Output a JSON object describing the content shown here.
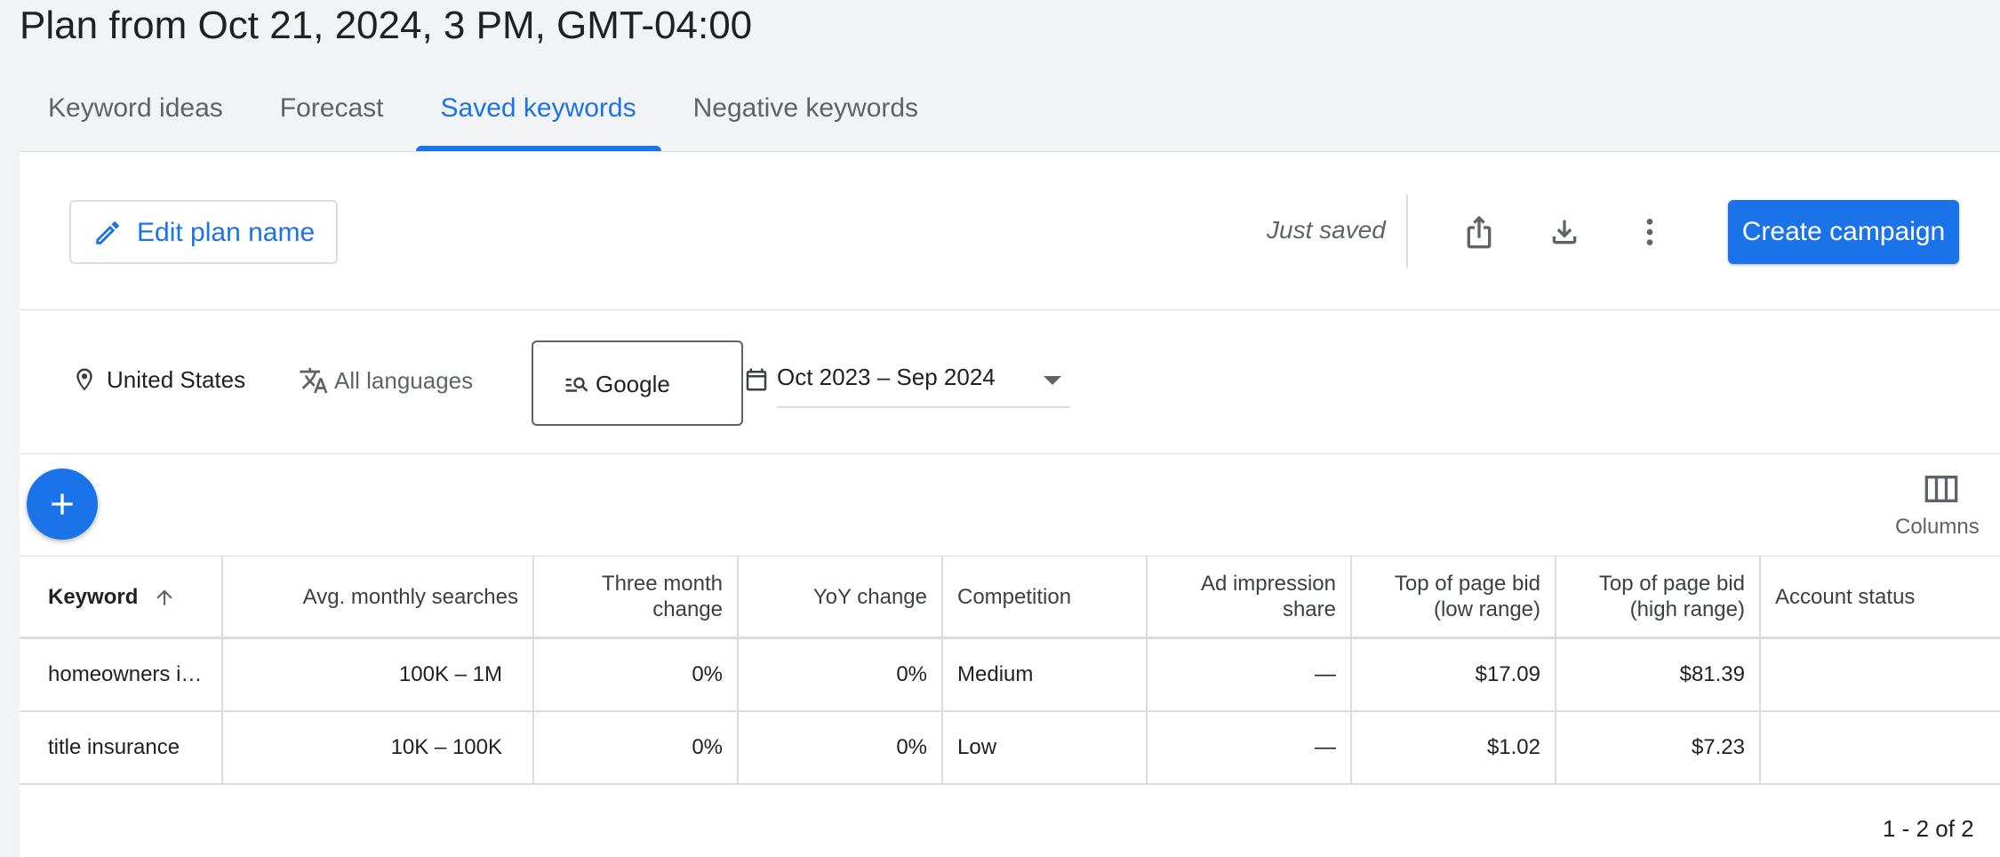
{
  "page": {
    "title": "Plan from Oct 21, 2024, 3 PM, GMT-04:00"
  },
  "tabs": [
    {
      "label": "Keyword ideas"
    },
    {
      "label": "Forecast"
    },
    {
      "label": "Saved keywords"
    },
    {
      "label": "Negative keywords"
    }
  ],
  "active_tab": "Saved keywords",
  "toolbar": {
    "edit_label": "Edit plan name",
    "status": "Just saved",
    "create_label": "Create campaign",
    "icons": [
      "pencil-icon",
      "share-icon",
      "download-icon",
      "more-vert-icon"
    ]
  },
  "filters": {
    "location": "United States",
    "language": "All languages",
    "network": "Google",
    "date_range": "Oct 2023 – Sep 2024"
  },
  "columns_label": "Columns",
  "table": {
    "headers": [
      {
        "label": "Keyword"
      },
      {
        "label": "Avg. monthly searches"
      },
      {
        "label": "Three month change"
      },
      {
        "label": "YoY change"
      },
      {
        "label": "Competition"
      },
      {
        "label": "Ad impression share"
      },
      {
        "label": "Top of page bid (low range)"
      },
      {
        "label": "Top of page bid (high range)"
      },
      {
        "label": "Account status"
      }
    ],
    "rows": [
      {
        "keyword": "homeowners i…",
        "searches": "100K – 1M",
        "three_month": "0%",
        "yoy": "0%",
        "competition": "Medium",
        "impression_share": "—",
        "bid_low": "$17.09",
        "bid_high": "$81.39",
        "account_status": ""
      },
      {
        "keyword": "title insurance",
        "searches": "10K – 100K",
        "three_month": "0%",
        "yoy": "0%",
        "competition": "Low",
        "impression_share": "—",
        "bid_low": "$1.02",
        "bid_high": "$7.23",
        "account_status": ""
      }
    ]
  },
  "pagination": "1 - 2 of 2",
  "colors": {
    "accent": "#1a73e8",
    "background": "#f1f3f4",
    "border": "#dadce0",
    "muted_text": "#5f6368"
  }
}
